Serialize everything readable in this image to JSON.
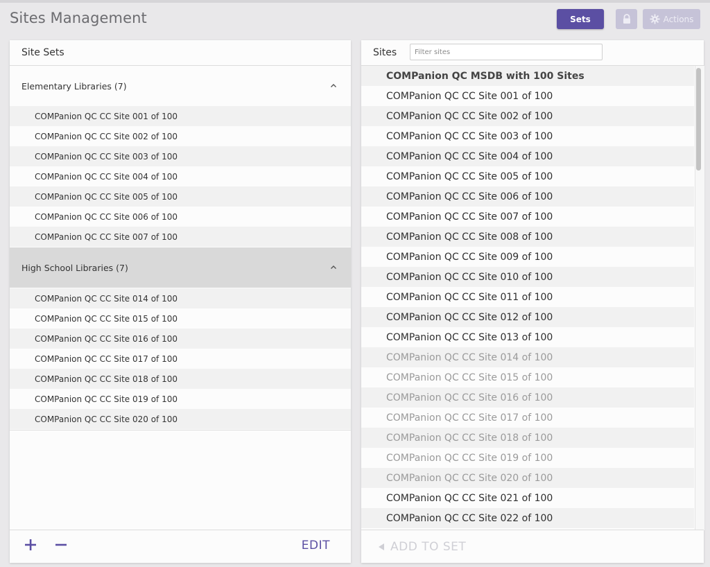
{
  "header": {
    "title": "Sites Management",
    "sets_label": "Sets",
    "actions_label": "Actions"
  },
  "colors": {
    "accent": "#5b4fa3",
    "disabled_button": "#c6c3d8",
    "selected_group_bg": "#d9d9d9",
    "member_site_text": "#9a9a9a"
  },
  "site_sets_panel": {
    "title": "Site Sets",
    "groups": [
      {
        "label": "Elementary Libraries (7)",
        "expanded": true,
        "sites": [
          "COMPanion QC CC Site 001 of 100",
          "COMPanion QC CC Site 002 of 100",
          "COMPanion QC CC Site 003 of 100",
          "COMPanion QC CC Site 004 of 100",
          "COMPanion QC CC Site 005 of 100",
          "COMPanion QC CC Site 006 of 100",
          "COMPanion QC CC Site 007 of 100"
        ]
      },
      {
        "label": "High School Libraries (7)",
        "expanded": true,
        "selected": true,
        "sites": [
          "COMPanion QC CC Site 014 of 100",
          "COMPanion QC CC Site 015 of 100",
          "COMPanion QC CC Site 016 of 100",
          "COMPanion QC CC Site 017 of 100",
          "COMPanion QC CC Site 018 of 100",
          "COMPanion QC CC Site 019 of 100",
          "COMPanion QC CC Site 020 of 100"
        ]
      }
    ],
    "footer": {
      "edit_label": "EDIT"
    }
  },
  "sites_panel": {
    "title": "Sites",
    "filter_placeholder": "Filter sites",
    "sites": [
      {
        "label": "COMPanion QC MSDB with 100 Sites",
        "kind": "root"
      },
      {
        "label": "COMPanion QC CC Site 001 of 100",
        "kind": "normal"
      },
      {
        "label": "COMPanion QC CC Site 002 of 100",
        "kind": "normal"
      },
      {
        "label": "COMPanion QC CC Site 003 of 100",
        "kind": "normal"
      },
      {
        "label": "COMPanion QC CC Site 004 of 100",
        "kind": "normal"
      },
      {
        "label": "COMPanion QC CC Site 005 of 100",
        "kind": "normal"
      },
      {
        "label": "COMPanion QC CC Site 006 of 100",
        "kind": "normal"
      },
      {
        "label": "COMPanion QC CC Site 007 of 100",
        "kind": "normal"
      },
      {
        "label": "COMPanion QC CC Site 008 of 100",
        "kind": "normal"
      },
      {
        "label": "COMPanion QC CC Site 009 of 100",
        "kind": "normal"
      },
      {
        "label": "COMPanion QC CC Site 010 of 100",
        "kind": "normal"
      },
      {
        "label": "COMPanion QC CC Site 011 of 100",
        "kind": "normal"
      },
      {
        "label": "COMPanion QC CC Site 012 of 100",
        "kind": "normal"
      },
      {
        "label": "COMPanion QC CC Site 013 of 100",
        "kind": "normal"
      },
      {
        "label": "COMPanion QC CC Site 014 of 100",
        "kind": "member"
      },
      {
        "label": "COMPanion QC CC Site 015 of 100",
        "kind": "member"
      },
      {
        "label": "COMPanion QC CC Site 016 of 100",
        "kind": "member"
      },
      {
        "label": "COMPanion QC CC Site 017 of 100",
        "kind": "member"
      },
      {
        "label": "COMPanion QC CC Site 018 of 100",
        "kind": "member"
      },
      {
        "label": "COMPanion QC CC Site 019 of 100",
        "kind": "member"
      },
      {
        "label": "COMPanion QC CC Site 020 of 100",
        "kind": "member"
      },
      {
        "label": "COMPanion QC CC Site 021 of 100",
        "kind": "normal"
      },
      {
        "label": "COMPanion QC CC Site 022 of 100",
        "kind": "normal"
      }
    ],
    "footer": {
      "add_to_set_label": "ADD TO SET"
    }
  }
}
